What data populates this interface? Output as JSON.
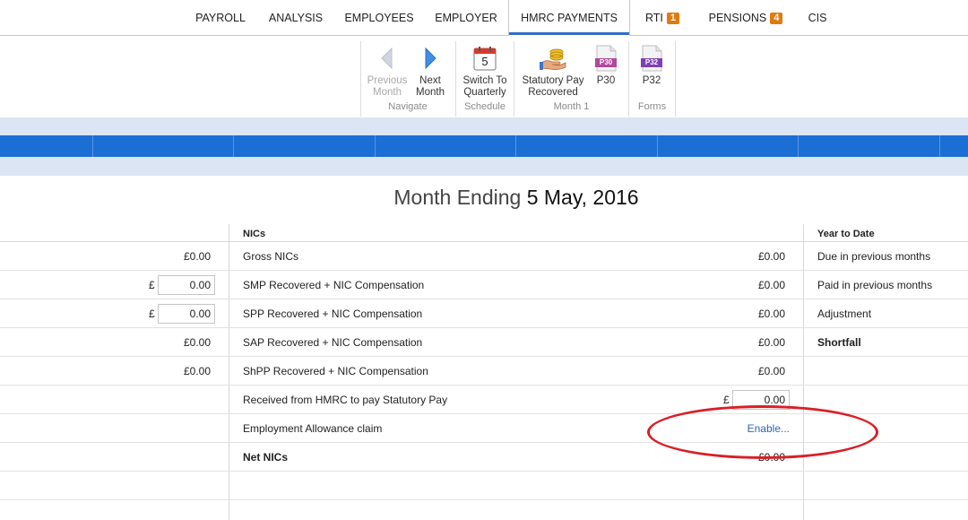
{
  "nav": {
    "tabs": [
      {
        "label": "PAYROLL"
      },
      {
        "label": "ANALYSIS"
      },
      {
        "label": "EMPLOYEES"
      },
      {
        "label": "EMPLOYER"
      },
      {
        "label": "HMRC PAYMENTS",
        "active": true
      },
      {
        "label": "RTI",
        "badge": "1"
      },
      {
        "label": "PENSIONS",
        "badge": "4"
      },
      {
        "label": "CIS"
      }
    ]
  },
  "ribbon": {
    "navigate": {
      "label": "Navigate",
      "previous": {
        "line1": "Previous",
        "line2": "Month"
      },
      "next": {
        "line1": "Next",
        "line2": "Month"
      }
    },
    "schedule": {
      "label": "Schedule",
      "switch": {
        "line1": "Switch To",
        "line2": "Quarterly",
        "calendar_day": "5"
      }
    },
    "month": {
      "label": "Month 1",
      "statutory": {
        "line1": "Statutory Pay",
        "line2": "Recovered"
      },
      "p30": {
        "label": "P30",
        "icon_text": "P30"
      }
    },
    "forms": {
      "label": "Forms",
      "p32": {
        "label": "P32",
        "icon_text": "P32"
      }
    }
  },
  "heading": {
    "prefix": "Month Ending",
    "date": "5 May, 2016"
  },
  "columns": {
    "nics": "NICs",
    "ytd": "Year to Date"
  },
  "left_values": [
    {
      "type": "text",
      "value": "£0.00"
    },
    {
      "type": "input",
      "currency": "£",
      "value": "0.00"
    },
    {
      "type": "input",
      "currency": "£",
      "value": "0.00"
    },
    {
      "type": "text",
      "value": "£0.00"
    },
    {
      "type": "text",
      "value": "£0.00"
    }
  ],
  "nics_rows": [
    {
      "label": "Gross NICs",
      "value": "£0.00"
    },
    {
      "label": "SMP Recovered + NIC Compensation",
      "value": "£0.00"
    },
    {
      "label": "SPP Recovered + NIC Compensation",
      "value": "£0.00"
    },
    {
      "label": "SAP Recovered + NIC Compensation",
      "value": "£0.00"
    },
    {
      "label": "ShPP Recovered + NIC Compensation",
      "value": "£0.00"
    },
    {
      "label": "Received from HMRC to pay Statutory Pay",
      "currency": "£",
      "input_value": "0.00"
    },
    {
      "label": "Employment Allowance claim",
      "link": "Enable..."
    },
    {
      "label": "Net NICs",
      "value": "£0.00"
    }
  ],
  "ytd_rows": [
    {
      "label": "Due in previous months"
    },
    {
      "label": "Paid in previous months"
    },
    {
      "label": "Adjustment"
    },
    {
      "label": "Shortfall"
    }
  ],
  "colors": {
    "accent_blue": "#1b6fd4",
    "band_light": "#dbe5f4",
    "badge_orange": "#e07b0e",
    "annotation_red": "#d91f26"
  }
}
